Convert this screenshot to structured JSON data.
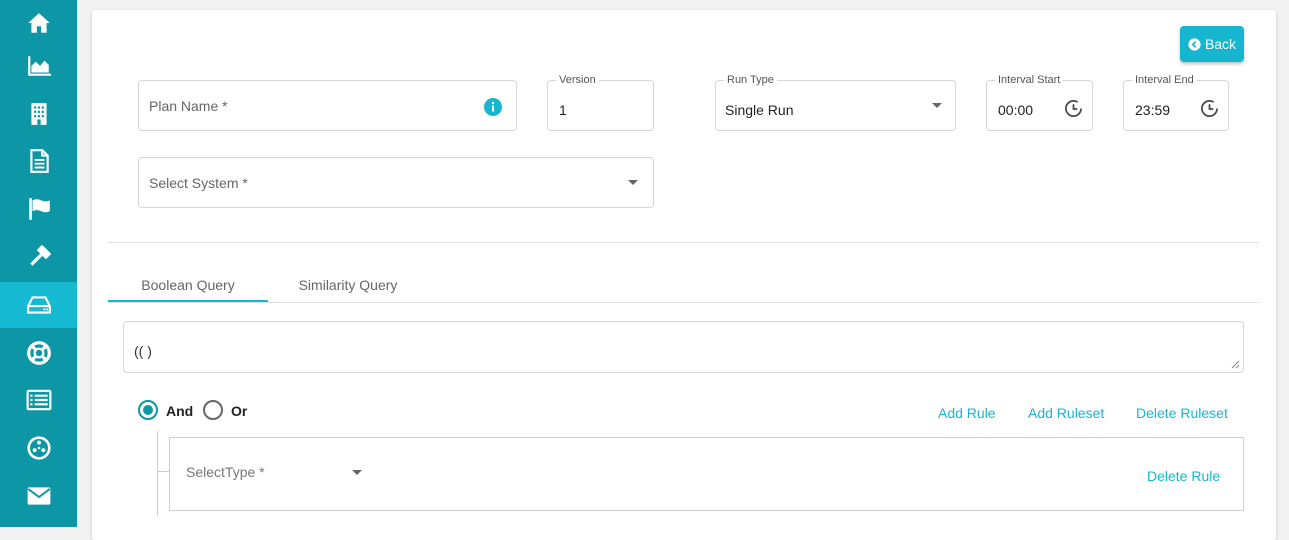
{
  "sidebar": {
    "items": [
      {
        "icon": "home-icon"
      },
      {
        "icon": "area-chart-icon"
      },
      {
        "icon": "building-icon"
      },
      {
        "icon": "document-icon"
      },
      {
        "icon": "flag-icon"
      },
      {
        "icon": "gavel-icon"
      },
      {
        "icon": "hard-drive-icon",
        "active": true
      },
      {
        "icon": "life-ring-icon"
      },
      {
        "icon": "list-icon"
      },
      {
        "icon": "network-icon"
      },
      {
        "icon": "envelope-icon"
      }
    ],
    "bg_color": "#0d97a6",
    "active_color": "#15b9d1"
  },
  "header": {
    "back_label": "Back"
  },
  "form": {
    "plan_name_placeholder": "Plan Name *",
    "version_label": "Version",
    "version_value": "1",
    "run_type_label": "Run Type",
    "run_type_value": "Single Run",
    "interval_start_label": "Interval Start",
    "interval_start_value": "00:00",
    "interval_end_label": "Interval End",
    "interval_end_value": "23:59",
    "select_system_placeholder": "Select System *"
  },
  "tabs": [
    {
      "label": "Boolean Query",
      "active": true
    },
    {
      "label": "Similarity Query",
      "active": false
    }
  ],
  "query": {
    "text": "(( )"
  },
  "builder": {
    "and_label": "And",
    "or_label": "Or",
    "selected": "And",
    "add_rule_label": "Add Rule",
    "add_ruleset_label": "Add Ruleset",
    "delete_ruleset_label": "Delete Ruleset",
    "rule": {
      "type_placeholder": "SelectType *",
      "delete_rule_label": "Delete Rule"
    }
  },
  "colors": {
    "accent": "#17b6d0",
    "primary": "#0d97a6"
  }
}
